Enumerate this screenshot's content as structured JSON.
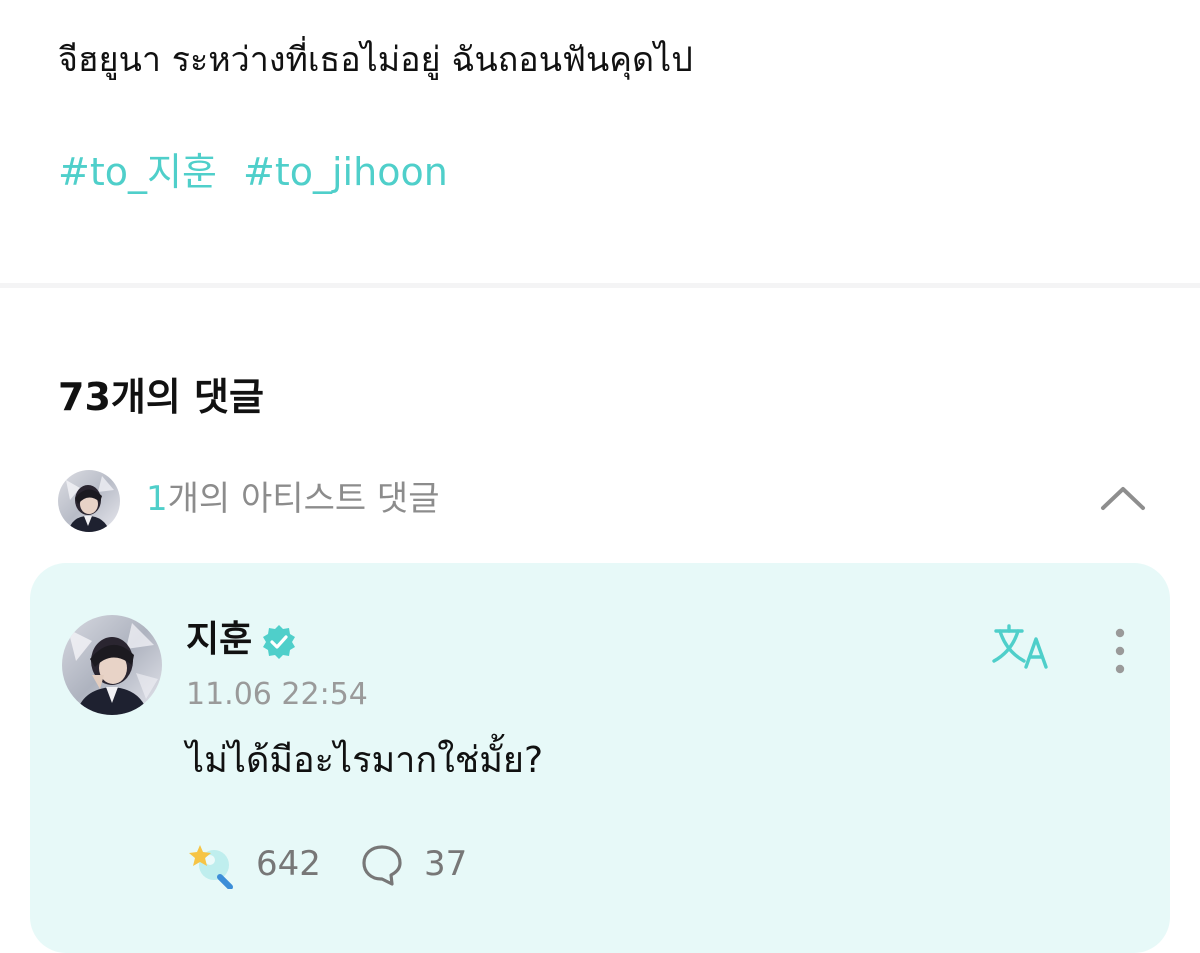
{
  "post": {
    "text": "จีฮยูนา ระหว่างที่เธอไม่อยู่ ฉันถอนฟันคุดไป",
    "hashtags": [
      "#to_지훈",
      "#to_jihoon"
    ]
  },
  "comments": {
    "count_label": "73개의 댓글",
    "artist_section": {
      "count": "1",
      "label": "개의 아티스트 댓글"
    }
  },
  "comment": {
    "author": "지훈",
    "timestamp": "11.06 22:54",
    "body": "ไม่ได้มีอะไรมากใช่มั้ย?",
    "reactions": "642",
    "replies": "37"
  },
  "icons": {
    "collapse": "chevron-up-icon",
    "verified": "verified-badge-icon",
    "translate": "translate-icon",
    "more": "more-vertical-icon",
    "reaction": "star-wand-reaction-icon",
    "reply": "speech-bubble-icon"
  },
  "colors": {
    "accent": "#4fcfca",
    "card_background": "#e7f9f8",
    "muted_text": "#8c8c8c"
  }
}
